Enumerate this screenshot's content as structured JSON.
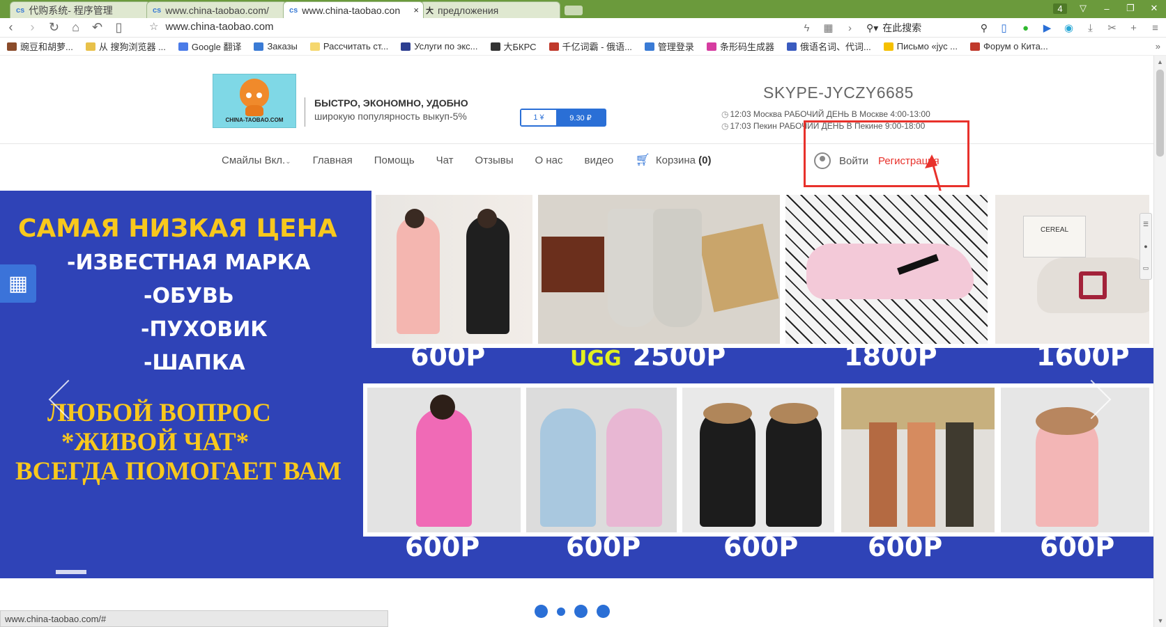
{
  "browser": {
    "tabs": [
      {
        "title": "代购系统- 程序管理",
        "icon": "cs-favicon"
      },
      {
        "title": "www.china-taobao.com/",
        "icon": "cs-favicon"
      },
      {
        "title": "www.china-taobao.con",
        "icon": "cs-favicon",
        "active": true,
        "close": "×"
      },
      {
        "title": "предложения",
        "icon": "bkrs-favicon"
      }
    ],
    "window_badge": "4",
    "url": "www.china-taobao.com",
    "search_placeholder": "在此搜索",
    "bookmarks": [
      {
        "label": "豌豆和胡萝...",
        "color": "#8a4b2a"
      },
      {
        "label": "从 搜狗浏览器 ...",
        "color": "#e8c14a"
      },
      {
        "label": "Google 翻译",
        "color": "#4a7be8"
      },
      {
        "label": "Заказы",
        "color": "#3a7bd5"
      },
      {
        "label": "Рассчитать ст...",
        "color": "#f5d76e"
      },
      {
        "label": "Услуги по экс...",
        "color": "#2c3e90"
      },
      {
        "label": "大БКРС",
        "color": "#333333"
      },
      {
        "label": "千亿词霸 - 俄语...",
        "color": "#c0392b"
      },
      {
        "label": "管理登录",
        "color": "#3a7bd5"
      },
      {
        "label": "条形码生成器",
        "color": "#d63ca0"
      },
      {
        "label": "俄语名词、代词...",
        "color": "#3a5bbf"
      },
      {
        "label": "Письмо «jyc ...",
        "color": "#f5c000"
      },
      {
        "label": "Форум о Кита...",
        "color": "#c0392b"
      }
    ],
    "bookmarks_more": "»",
    "status_url": "www.china-taobao.com/#"
  },
  "header": {
    "logo_text": "CHINA-TAOBAO.COM",
    "slogan_title": "БЫСТРО, ЭКОНОМНО, УДОБНО",
    "slogan_sub": "широкую популярность выкуп-5%",
    "rate_left": "1 ¥",
    "rate_right": "9.30 ₽",
    "skype": "SKYPE-JYCZY6685",
    "time_moscow": "12:03  Москва  РАБОЧИЙ ДЕНЬ В Москве 4:00-13:00",
    "time_beijing": "17:03  Пекин   РАБОЧИЙ ДЕНЬ В Пекине 9:00-18:00"
  },
  "nav": {
    "items": [
      "Смайлы Вкл.",
      "Главная",
      "Помощь",
      "Чат",
      "Отзывы",
      "О нас",
      "видео"
    ],
    "dropdown_mark": "⌄",
    "cart_label": "Корзина",
    "cart_count": "(0)",
    "login": "Войти",
    "register": "Регистрация"
  },
  "banner": {
    "headline": "САМАЯ НИЗКАЯ ЦЕНА",
    "lines": [
      "-ИЗВЕСТНАЯ МАРКА",
      "-ОБУВЬ",
      "-ПУХОВИК",
      "-ШАПКА"
    ],
    "promo": [
      "ЛЮБОЙ ВОПРОС",
      "*ЖИВОЙ ЧАТ*",
      "ВСЕГДА ПОМОГАЕТ ВАМ"
    ],
    "row1": [
      {
        "product": "down-coats-pink-black",
        "price": "600Р"
      },
      {
        "product": "ugg-boots",
        "brand": "UGG",
        "price": "2500Р"
      },
      {
        "product": "nike-sneakers",
        "price": "1800Р"
      },
      {
        "product": "cereal-sneakers",
        "price": "1600Р"
      }
    ],
    "row2": [
      {
        "product": "pink-coat",
        "price": "600Р"
      },
      {
        "product": "blue-pink-coats",
        "price": "600Р"
      },
      {
        "product": "black-fur-coats",
        "price": "600Р"
      },
      {
        "product": "fur-hoods",
        "price": "600Р"
      },
      {
        "product": "pink-fur-coat",
        "price": "600Р"
      }
    ],
    "slide_count": 4,
    "active_slide": 1
  },
  "colors": {
    "banner_bg": "#2f43b7",
    "accent_blue": "#2a6fd6",
    "highlight_red": "#e8312b",
    "headline_yellow": "#f8c81d"
  }
}
